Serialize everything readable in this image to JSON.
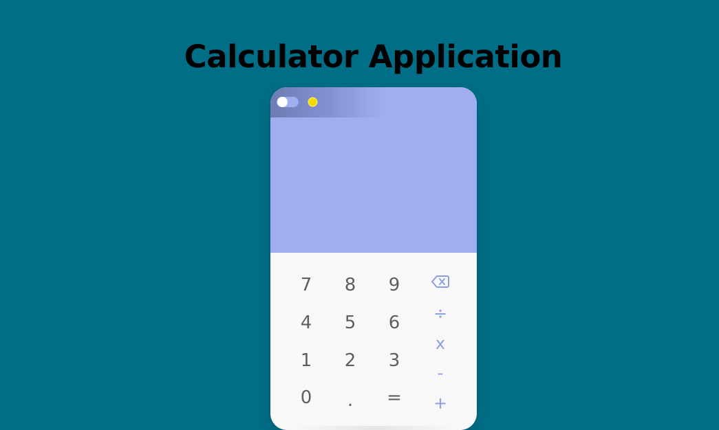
{
  "page": {
    "title": "Calculator Application"
  },
  "calculator": {
    "theme_toggle": {
      "state": "off"
    },
    "theme_icon": "sun-icon",
    "display": {
      "value": ""
    },
    "keys": {
      "seven": "7",
      "eight": "8",
      "nine": "9",
      "four": "4",
      "five": "5",
      "six": "6",
      "one": "1",
      "two": "2",
      "three": "3",
      "zero": "0",
      "dot": ".",
      "equals": "=",
      "divide": "÷",
      "multiply": "x",
      "subtract": "-",
      "add": "+"
    },
    "backspace_icon": "backspace-icon"
  },
  "colors": {
    "background": "#006e87",
    "display": "#9eaeee",
    "keypad": "#f8f8f8",
    "digit": "#5e5e5e",
    "operator": "#8e9ee6",
    "sun": "#f5d800"
  }
}
